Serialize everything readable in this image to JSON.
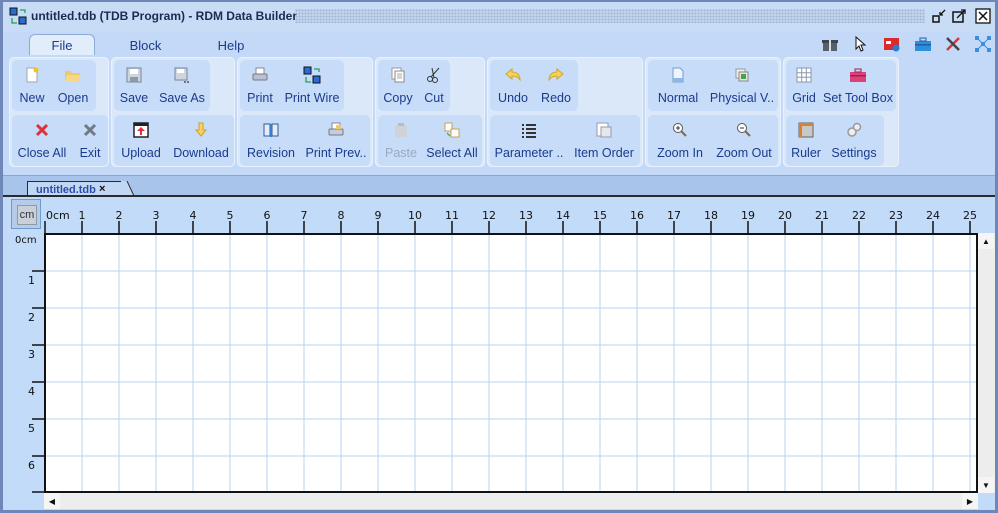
{
  "window": {
    "title": "untitled.tdb (TDB Program) - RDM Data Builder",
    "controls": [
      "restore-icon",
      "maximize-icon",
      "close-icon"
    ]
  },
  "ribbon_tabs": [
    {
      "label": "File",
      "active": true
    },
    {
      "label": "Block",
      "active": false
    },
    {
      "label": "Help",
      "active": false
    }
  ],
  "quick_tools": [
    "gift-icon",
    "pointer-icon",
    "dashboard-icon",
    "toolbox-icon",
    "tools-icon",
    "network-icon"
  ],
  "ribbon": {
    "row1": [
      {
        "label": "New",
        "icon": "new-file-icon"
      },
      {
        "label": "Open",
        "icon": "folder-open-icon"
      },
      {
        "label": "Save",
        "icon": "save-icon"
      },
      {
        "label": "Save As",
        "icon": "save-as-icon"
      },
      {
        "label": "Print",
        "icon": "print-icon"
      },
      {
        "label": "Print Wire",
        "icon": "print-wire-icon"
      },
      {
        "label": "Copy",
        "icon": "copy-icon"
      },
      {
        "label": "Cut",
        "icon": "cut-icon"
      },
      {
        "label": "Undo",
        "icon": "undo-icon"
      },
      {
        "label": "Redo",
        "icon": "redo-icon"
      },
      {
        "label": "Normal",
        "icon": "page-icon"
      },
      {
        "label": "Physical V..",
        "icon": "physical-view-icon"
      },
      {
        "label": "Grid",
        "icon": "grid-icon"
      },
      {
        "label": "Set Tool Box",
        "icon": "toolbox-icon"
      }
    ],
    "row2": [
      {
        "label": "Close All",
        "icon": "close-all-icon"
      },
      {
        "label": "Exit",
        "icon": "exit-icon"
      },
      {
        "label": "Upload",
        "icon": "upload-icon"
      },
      {
        "label": "Download",
        "icon": "download-icon"
      },
      {
        "label": "Revision",
        "icon": "book-icon"
      },
      {
        "label": "Print Prev..",
        "icon": "print-preview-icon"
      },
      {
        "label": "Paste",
        "icon": "paste-icon",
        "disabled": true
      },
      {
        "label": "Select All",
        "icon": "select-all-icon"
      },
      {
        "label": "Parameter ..",
        "icon": "list-icon"
      },
      {
        "label": "Item Order",
        "icon": "item-order-icon"
      },
      {
        "label": "Zoom In",
        "icon": "zoom-in-icon"
      },
      {
        "label": "Zoom Out",
        "icon": "zoom-out-icon"
      },
      {
        "label": "Ruler",
        "icon": "ruler-icon"
      },
      {
        "label": "Settings",
        "icon": "settings-icon"
      }
    ]
  },
  "document_tabs": [
    {
      "label": "untitled.tdb",
      "close": "×"
    }
  ],
  "editor": {
    "unit_button": "cm",
    "h_ruler_first": "0cm",
    "h_ruler_labels": [
      "1",
      "2",
      "3",
      "4",
      "5",
      "6",
      "7",
      "8",
      "9",
      "10",
      "11",
      "12",
      "13",
      "14",
      "15",
      "16",
      "17",
      "18",
      "19",
      "20",
      "21",
      "22",
      "23",
      "24",
      "25"
    ],
    "v_ruler_first": "0cm",
    "v_ruler_labels": [
      "1",
      "2",
      "3",
      "4",
      "5",
      "6"
    ]
  },
  "colors": {
    "accent": "#1a3b8c",
    "ribbon_bg": "#c3d9f7",
    "grid_line": "#b9d3f3"
  }
}
